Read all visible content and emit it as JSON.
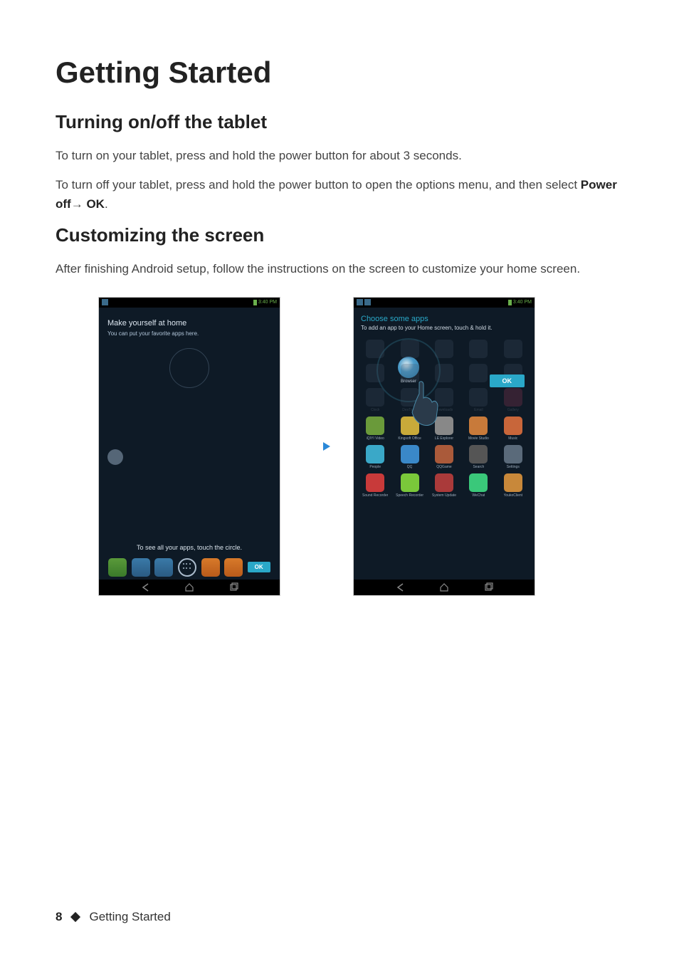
{
  "page": {
    "title": "Getting Started",
    "footer_page_number": "8",
    "footer_section": "Getting Started"
  },
  "section1": {
    "heading": "Turning on/off the tablet",
    "para1": "To turn on your tablet, press and hold the power button for about 3 seconds.",
    "para2_pre": "To turn off your tablet, press and hold the power button to open the options menu, and then select ",
    "para2_bold1": "Power off",
    "para2_arrow": "→ ",
    "para2_bold2": "OK",
    "para2_post": "."
  },
  "section2": {
    "heading": "Customizing the screen",
    "para1": "After finishing Android setup, follow the instructions on the screen to customize your home screen."
  },
  "screenshot_left": {
    "status_time": "3:40 PM",
    "title": "Make yourself at home",
    "subtitle": "You can put your favorite apps here.",
    "bottom_caption": "To see all your apps, touch the circle.",
    "ok_label": "OK"
  },
  "screenshot_right": {
    "status_time": "3:40 PM",
    "title": "Choose some apps",
    "subtitle": "To add an app to your Home screen, touch & hold it.",
    "spotlight_app_label": "Browser",
    "ok_label": "OK",
    "apps": [
      {
        "label": "",
        "color": "#445566"
      },
      {
        "label": "",
        "color": "#445566"
      },
      {
        "label": "",
        "color": "#445566"
      },
      {
        "label": "",
        "color": "#445566"
      },
      {
        "label": "",
        "color": "#445566"
      },
      {
        "label": "",
        "color": "#445566"
      },
      {
        "label": "",
        "color": "#445566"
      },
      {
        "label": "",
        "color": "#445566"
      },
      {
        "label": "",
        "color": "#445566"
      },
      {
        "label": "",
        "color": "#445566"
      },
      {
        "label": "Clock",
        "color": "#445566"
      },
      {
        "label": "DevTools",
        "color": "#445566"
      },
      {
        "label": "Downloads",
        "color": "#445566"
      },
      {
        "label": "Email",
        "color": "#445566"
      },
      {
        "label": "Gallery",
        "color": "#aa3a5a"
      },
      {
        "label": "iQIYI Video",
        "color": "#6a9a3a"
      },
      {
        "label": "Kingsoft Office",
        "color": "#c8aa3a"
      },
      {
        "label": "LE Explorer",
        "color": "#888888"
      },
      {
        "label": "Movie Studio",
        "color": "#c87a3a"
      },
      {
        "label": "Music",
        "color": "#c8663a"
      },
      {
        "label": "People",
        "color": "#3aa8c8"
      },
      {
        "label": "QQ",
        "color": "#3a88c8"
      },
      {
        "label": "QQGame",
        "color": "#aa5a3a"
      },
      {
        "label": "Search",
        "color": "#555555"
      },
      {
        "label": "Settings",
        "color": "#5a6a7a"
      },
      {
        "label": "Sound Recorder",
        "color": "#c83a3a"
      },
      {
        "label": "Speech Recorder",
        "color": "#7ac83a"
      },
      {
        "label": "System Update",
        "color": "#aa3a3a"
      },
      {
        "label": "WeChat",
        "color": "#3ac87a"
      },
      {
        "label": "YoukoClient",
        "color": "#c8883a"
      }
    ]
  }
}
